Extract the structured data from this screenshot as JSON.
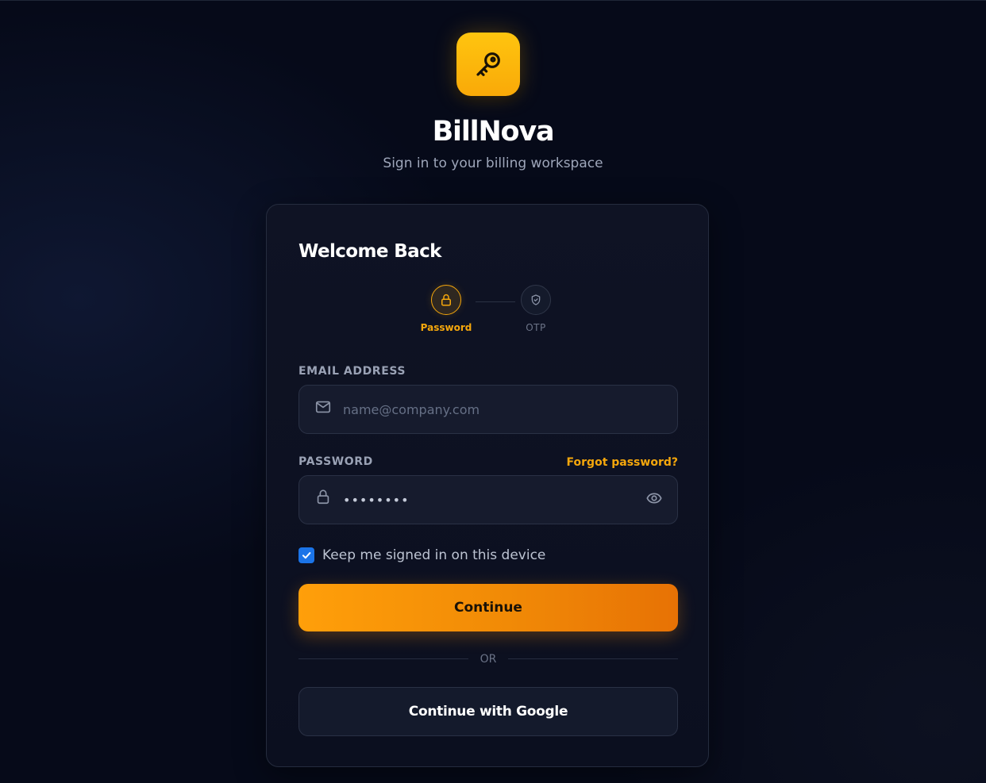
{
  "brand": {
    "logo_icon": "key-icon",
    "name": "BillNova",
    "tagline": "Sign in to your billing workspace",
    "accent_color": "#f5a70c"
  },
  "card": {
    "title": "Welcome Back",
    "steps": [
      {
        "label": "Password",
        "icon": "lock-icon",
        "state": "active"
      },
      {
        "label": "OTP",
        "icon": "shield-check-icon",
        "state": "inactive"
      }
    ],
    "email": {
      "label": "EMAIL ADDRESS",
      "icon": "mail-icon",
      "placeholder": "name@company.com",
      "value": ""
    },
    "password": {
      "label": "PASSWORD",
      "icon": "lock-icon",
      "value": "password",
      "forgot_label": "Forgot password?",
      "toggle_icon": "eye-icon"
    },
    "remember": {
      "label": "Keep me signed in on this device",
      "checked": true
    },
    "continue_label": "Continue",
    "divider_label": "OR",
    "google_label": "Continue with Google"
  }
}
